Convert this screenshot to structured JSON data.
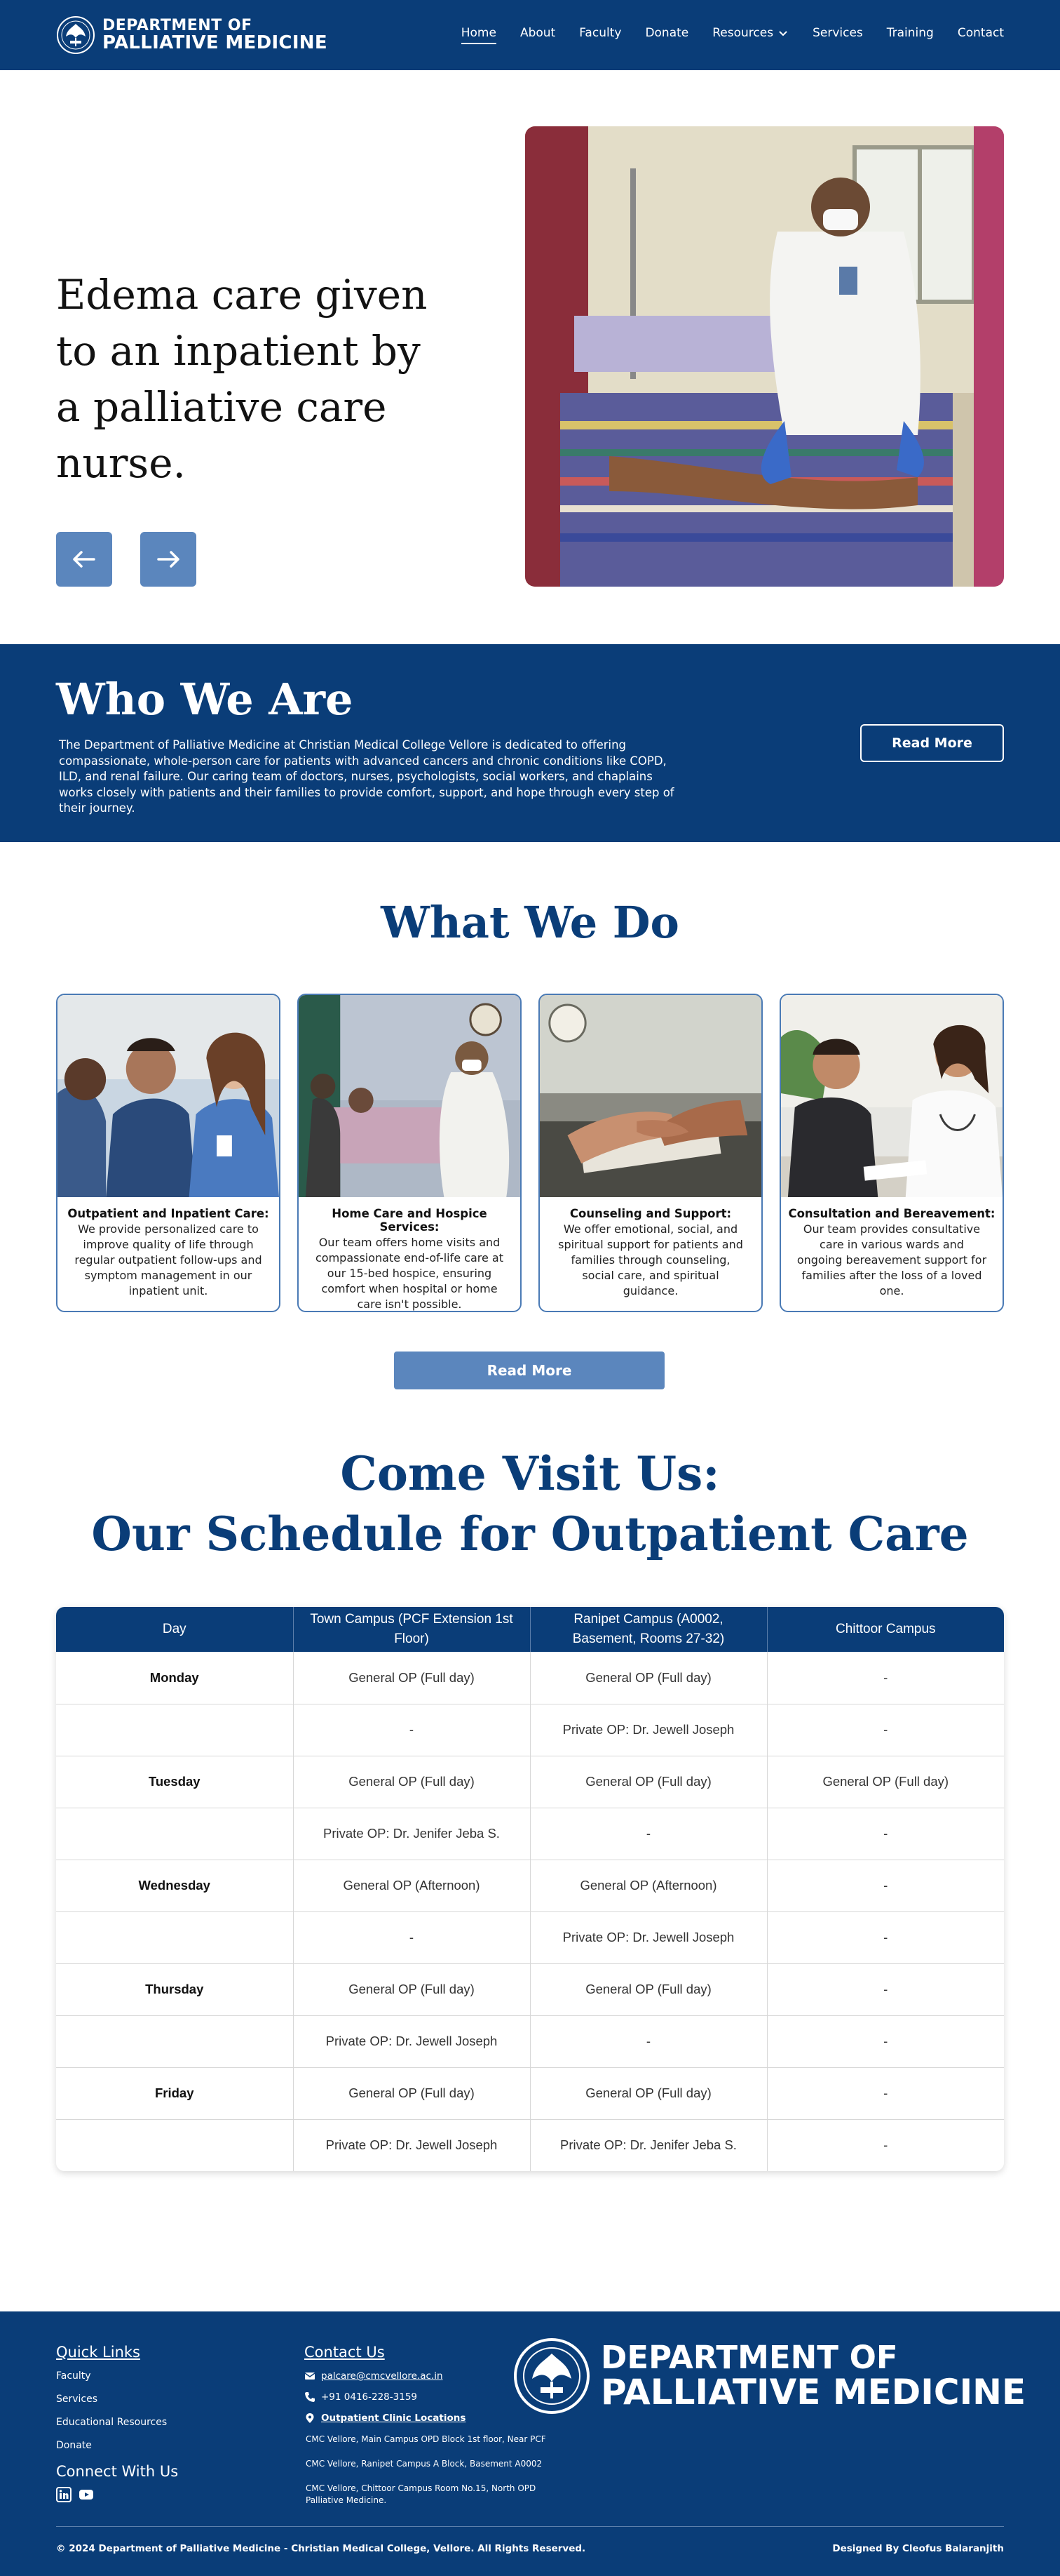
{
  "nav": {
    "brand_line1": "DEPARTMENT OF",
    "brand_line2": "PALLIATIVE MEDICINE",
    "items": [
      {
        "label": "Home"
      },
      {
        "label": "About"
      },
      {
        "label": "Faculty"
      },
      {
        "label": "Donate"
      },
      {
        "label": "Resources"
      },
      {
        "label": "Services"
      },
      {
        "label": "Training"
      },
      {
        "label": "Contact"
      }
    ]
  },
  "hero": {
    "caption": "Edema care given to an inpatient by a palliative care nurse."
  },
  "who": {
    "title": "Who We Are",
    "text": "The Department of Palliative Medicine at Christian Medical College Vellore is dedicated to offering compassionate, whole-person care for patients with advanced cancers and chronic conditions like COPD, ILD, and renal failure. Our caring team of doctors, nurses, psychologists, social workers, and chaplains works closely with patients and their families to provide comfort, support, and hope through every step of their journey.",
    "button": "Read More"
  },
  "what": {
    "title": "What We Do",
    "cards": [
      {
        "title": "Outpatient and Inpatient Care:",
        "text": "We provide personalized care to improve quality of life through regular outpatient follow-ups and symptom management in our inpatient unit."
      },
      {
        "title": "Home Care and Hospice Services:",
        "text": "Our team offers home visits and compassionate end-of-life care at our 15-bed hospice, ensuring comfort when hospital or home care isn't possible."
      },
      {
        "title": "Counseling and Support:",
        "text": "We offer emotional, social, and spiritual support for patients and families through counseling, social care, and spiritual guidance."
      },
      {
        "title": "Consultation and Bereavement:",
        "text": "Our team provides consultative care in various wards and ongoing bereavement support for families after the loss of a loved one."
      }
    ],
    "button": "Read More"
  },
  "schedule": {
    "title_line1": "Come Visit Us:",
    "title_line2": "Our Schedule for Outpatient Care",
    "headers": [
      "Day",
      "Town Campus (PCF Extension 1st Floor)",
      "Ranipet Campus (A0002, Basement, Rooms 27-32)",
      "Chittoor Campus"
    ],
    "rows": [
      [
        "Monday",
        "General OP (Full day)",
        "General OP (Full day)",
        "-"
      ],
      [
        "",
        "-",
        "Private OP: Dr. Jewell Joseph",
        "-"
      ],
      [
        "Tuesday",
        "General OP (Full day)",
        "General OP (Full day)",
        "General OP (Full day)"
      ],
      [
        "",
        "Private OP: Dr. Jenifer Jeba S.",
        "-",
        "-"
      ],
      [
        "Wednesday",
        "General OP (Afternoon)",
        "General OP (Afternoon)",
        "-"
      ],
      [
        "",
        "-",
        "Private OP: Dr. Jewell Joseph",
        "-"
      ],
      [
        "Thursday",
        "General OP (Full day)",
        "General OP (Full day)",
        "-"
      ],
      [
        "",
        "Private OP: Dr. Jewell Joseph",
        "-",
        "-"
      ],
      [
        "Friday",
        "General OP (Full day)",
        "General OP (Full day)",
        "-"
      ],
      [
        "",
        "Private OP: Dr. Jewell Joseph",
        "Private OP: Dr. Jenifer Jeba S.",
        "-"
      ]
    ]
  },
  "footer": {
    "quick_links_title": "Quick Links",
    "quick_links": [
      "Faculty",
      "Services",
      "Educational Resources",
      "Donate"
    ],
    "connect_title": "Connect With Us",
    "contact_title": "Contact Us",
    "email": "palcare@cmcvellore.ac.in",
    "phone": "+91 0416-228-3159",
    "locations_title": "Outpatient Clinic Locations",
    "locations": [
      "CMC Vellore, Main Campus OPD Block 1st floor, Near PCF",
      "CMC Vellore, Ranipet Campus A Block, Basement A0002",
      "CMC Vellore, Chittoor Campus Room No.15, North OPD Palliative Medicine."
    ],
    "brand_line1": "DEPARTMENT OF",
    "brand_line2": "PALLIATIVE MEDICINE",
    "copyright": "© 2024 Department of Palliative Medicine - Christian Medical College, Vellore. All Rights Reserved.",
    "designer": "Designed By Cleofus Balaranjith"
  }
}
